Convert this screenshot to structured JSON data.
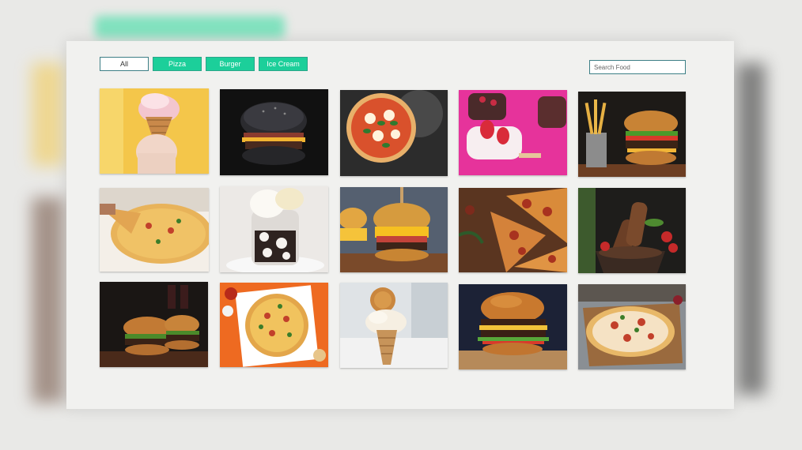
{
  "filters": {
    "all": "All",
    "pizza": "Pizza",
    "burger": "Burger",
    "ice_cream": "Ice Cream",
    "active": "All"
  },
  "search": {
    "placeholder": "Search Food"
  },
  "colors": {
    "accent": "#1ccf9a",
    "accent_border": "#2aa58a",
    "search_border": "#3d7f86"
  },
  "gallery": [
    {
      "category": "ice-cream",
      "subject": "ice-cream-cone-on-yellow"
    },
    {
      "category": "burger",
      "subject": "black-bun-burger"
    },
    {
      "category": "pizza",
      "subject": "margherita-pizza-on-dark-board"
    },
    {
      "category": "ice-cream",
      "subject": "strawberry-ice-cream-bars-on-pink"
    },
    {
      "category": "burger",
      "subject": "burger-with-fries"
    },
    {
      "category": "pizza",
      "subject": "pizza-slice-being-lifted"
    },
    {
      "category": "ice-cream",
      "subject": "ice-cream-sundae-in-glass"
    },
    {
      "category": "burger",
      "subject": "cheeseburger-on-board"
    },
    {
      "category": "pizza",
      "subject": "pepperoni-pizza-slices"
    },
    {
      "category": "ice-cream",
      "subject": "chocolate-ice-cream-bars-with-strawberries"
    },
    {
      "category": "burger",
      "subject": "two-burgers-with-drinks"
    },
    {
      "category": "pizza",
      "subject": "pizza-on-orange-background"
    },
    {
      "category": "ice-cream",
      "subject": "ice-cream-cone-with-waffle"
    },
    {
      "category": "burger",
      "subject": "double-cheeseburger-on-dark"
    },
    {
      "category": "pizza",
      "subject": "rustic-pizza-on-wood"
    }
  ]
}
